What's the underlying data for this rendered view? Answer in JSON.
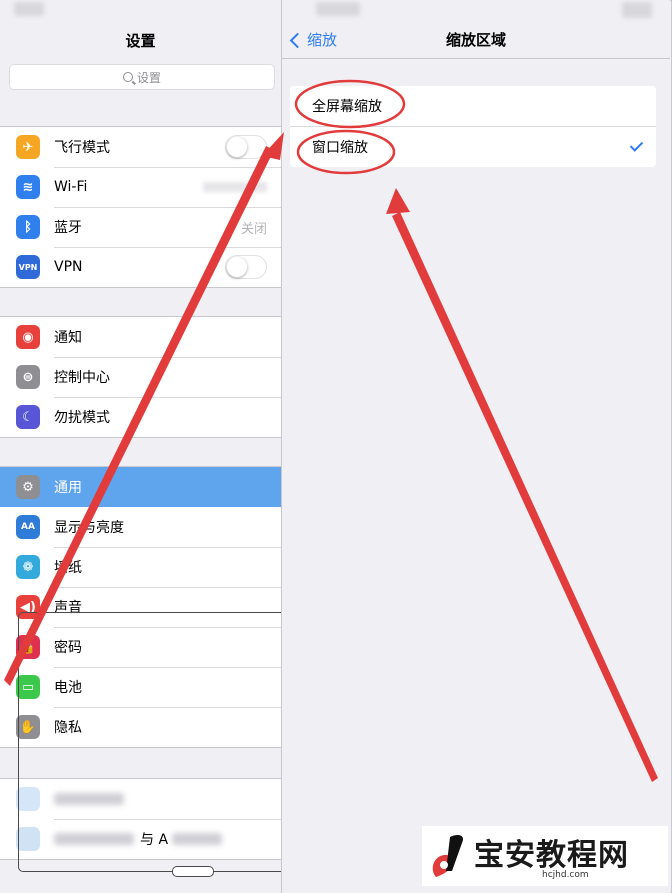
{
  "left_pane": {
    "title": "设置",
    "search_placeholder": "设置",
    "groups": [
      [
        {
          "label": "飞行模式",
          "icon": "airplane-icon",
          "color": "#f5a623",
          "glyph": "✈",
          "accessory": "toggle"
        },
        {
          "label": "Wi-Fi",
          "icon": "wifi-icon",
          "color": "#2f80ed",
          "glyph": "≋",
          "accessory": "blurred"
        },
        {
          "label": "蓝牙",
          "icon": "bluetooth-icon",
          "color": "#2f80ed",
          "glyph": "ᛒ",
          "accessory": "detail",
          "detail": "关闭"
        },
        {
          "label": "VPN",
          "icon": "vpn-icon",
          "color": "#2f6bd8",
          "glyph": "VPN",
          "accessory": "toggle"
        }
      ],
      [
        {
          "label": "通知",
          "icon": "notifications-icon",
          "color": "#e8413c",
          "glyph": "◉",
          "accessory": ""
        },
        {
          "label": "控制中心",
          "icon": "control-center-icon",
          "color": "#8e8e93",
          "glyph": "⊜",
          "accessory": ""
        },
        {
          "label": "勿扰模式",
          "icon": "do-not-disturb-icon",
          "color": "#5856d6",
          "glyph": "☾",
          "accessory": ""
        }
      ],
      [
        {
          "label": "通用",
          "icon": "general-gear-icon",
          "color": "#8e8e93",
          "glyph": "⚙",
          "accessory": "",
          "selected": true
        },
        {
          "label": "显示与亮度",
          "icon": "display-brightness-icon",
          "color": "#2f7bd8",
          "glyph": "AA",
          "accessory": ""
        },
        {
          "label": "墙纸",
          "icon": "wallpaper-icon",
          "color": "#34aadc",
          "glyph": "❁",
          "accessory": ""
        },
        {
          "label": "声音",
          "icon": "sounds-icon",
          "color": "#e8413c",
          "glyph": "◀)",
          "accessory": ""
        },
        {
          "label": "密码",
          "icon": "passcode-lock-icon",
          "color": "#e0304f",
          "glyph": "🔒",
          "accessory": ""
        },
        {
          "label": "电池",
          "icon": "battery-icon",
          "color": "#3cc84a",
          "glyph": "▭",
          "accessory": ""
        },
        {
          "label": "隐私",
          "icon": "privacy-hand-icon",
          "color": "#8e8e93",
          "glyph": "✋",
          "accessory": ""
        }
      ],
      [
        {
          "label": "",
          "icon": "icloud-icon",
          "color": "#d4e6f7",
          "glyph": "",
          "accessory": "",
          "blurred_label": true
        },
        {
          "label": "与 A",
          "icon": "itunes-appstore-icon",
          "color": "#cfe3f5",
          "glyph": "",
          "accessory": "",
          "blurred_label": true
        }
      ]
    ]
  },
  "right_pane": {
    "back_label": "缩放",
    "title": "缩放区域",
    "options": [
      {
        "label": "全屏幕缩放",
        "checked": false
      },
      {
        "label": "窗口缩放",
        "checked": true
      }
    ]
  },
  "annotations": {
    "accent_red": "#e23b3b",
    "highlight_color": "#5fa5ee",
    "link_color": "#2d7cf6"
  },
  "watermark": {
    "brand": "宝安教程网",
    "url": "hcjhd.com"
  }
}
